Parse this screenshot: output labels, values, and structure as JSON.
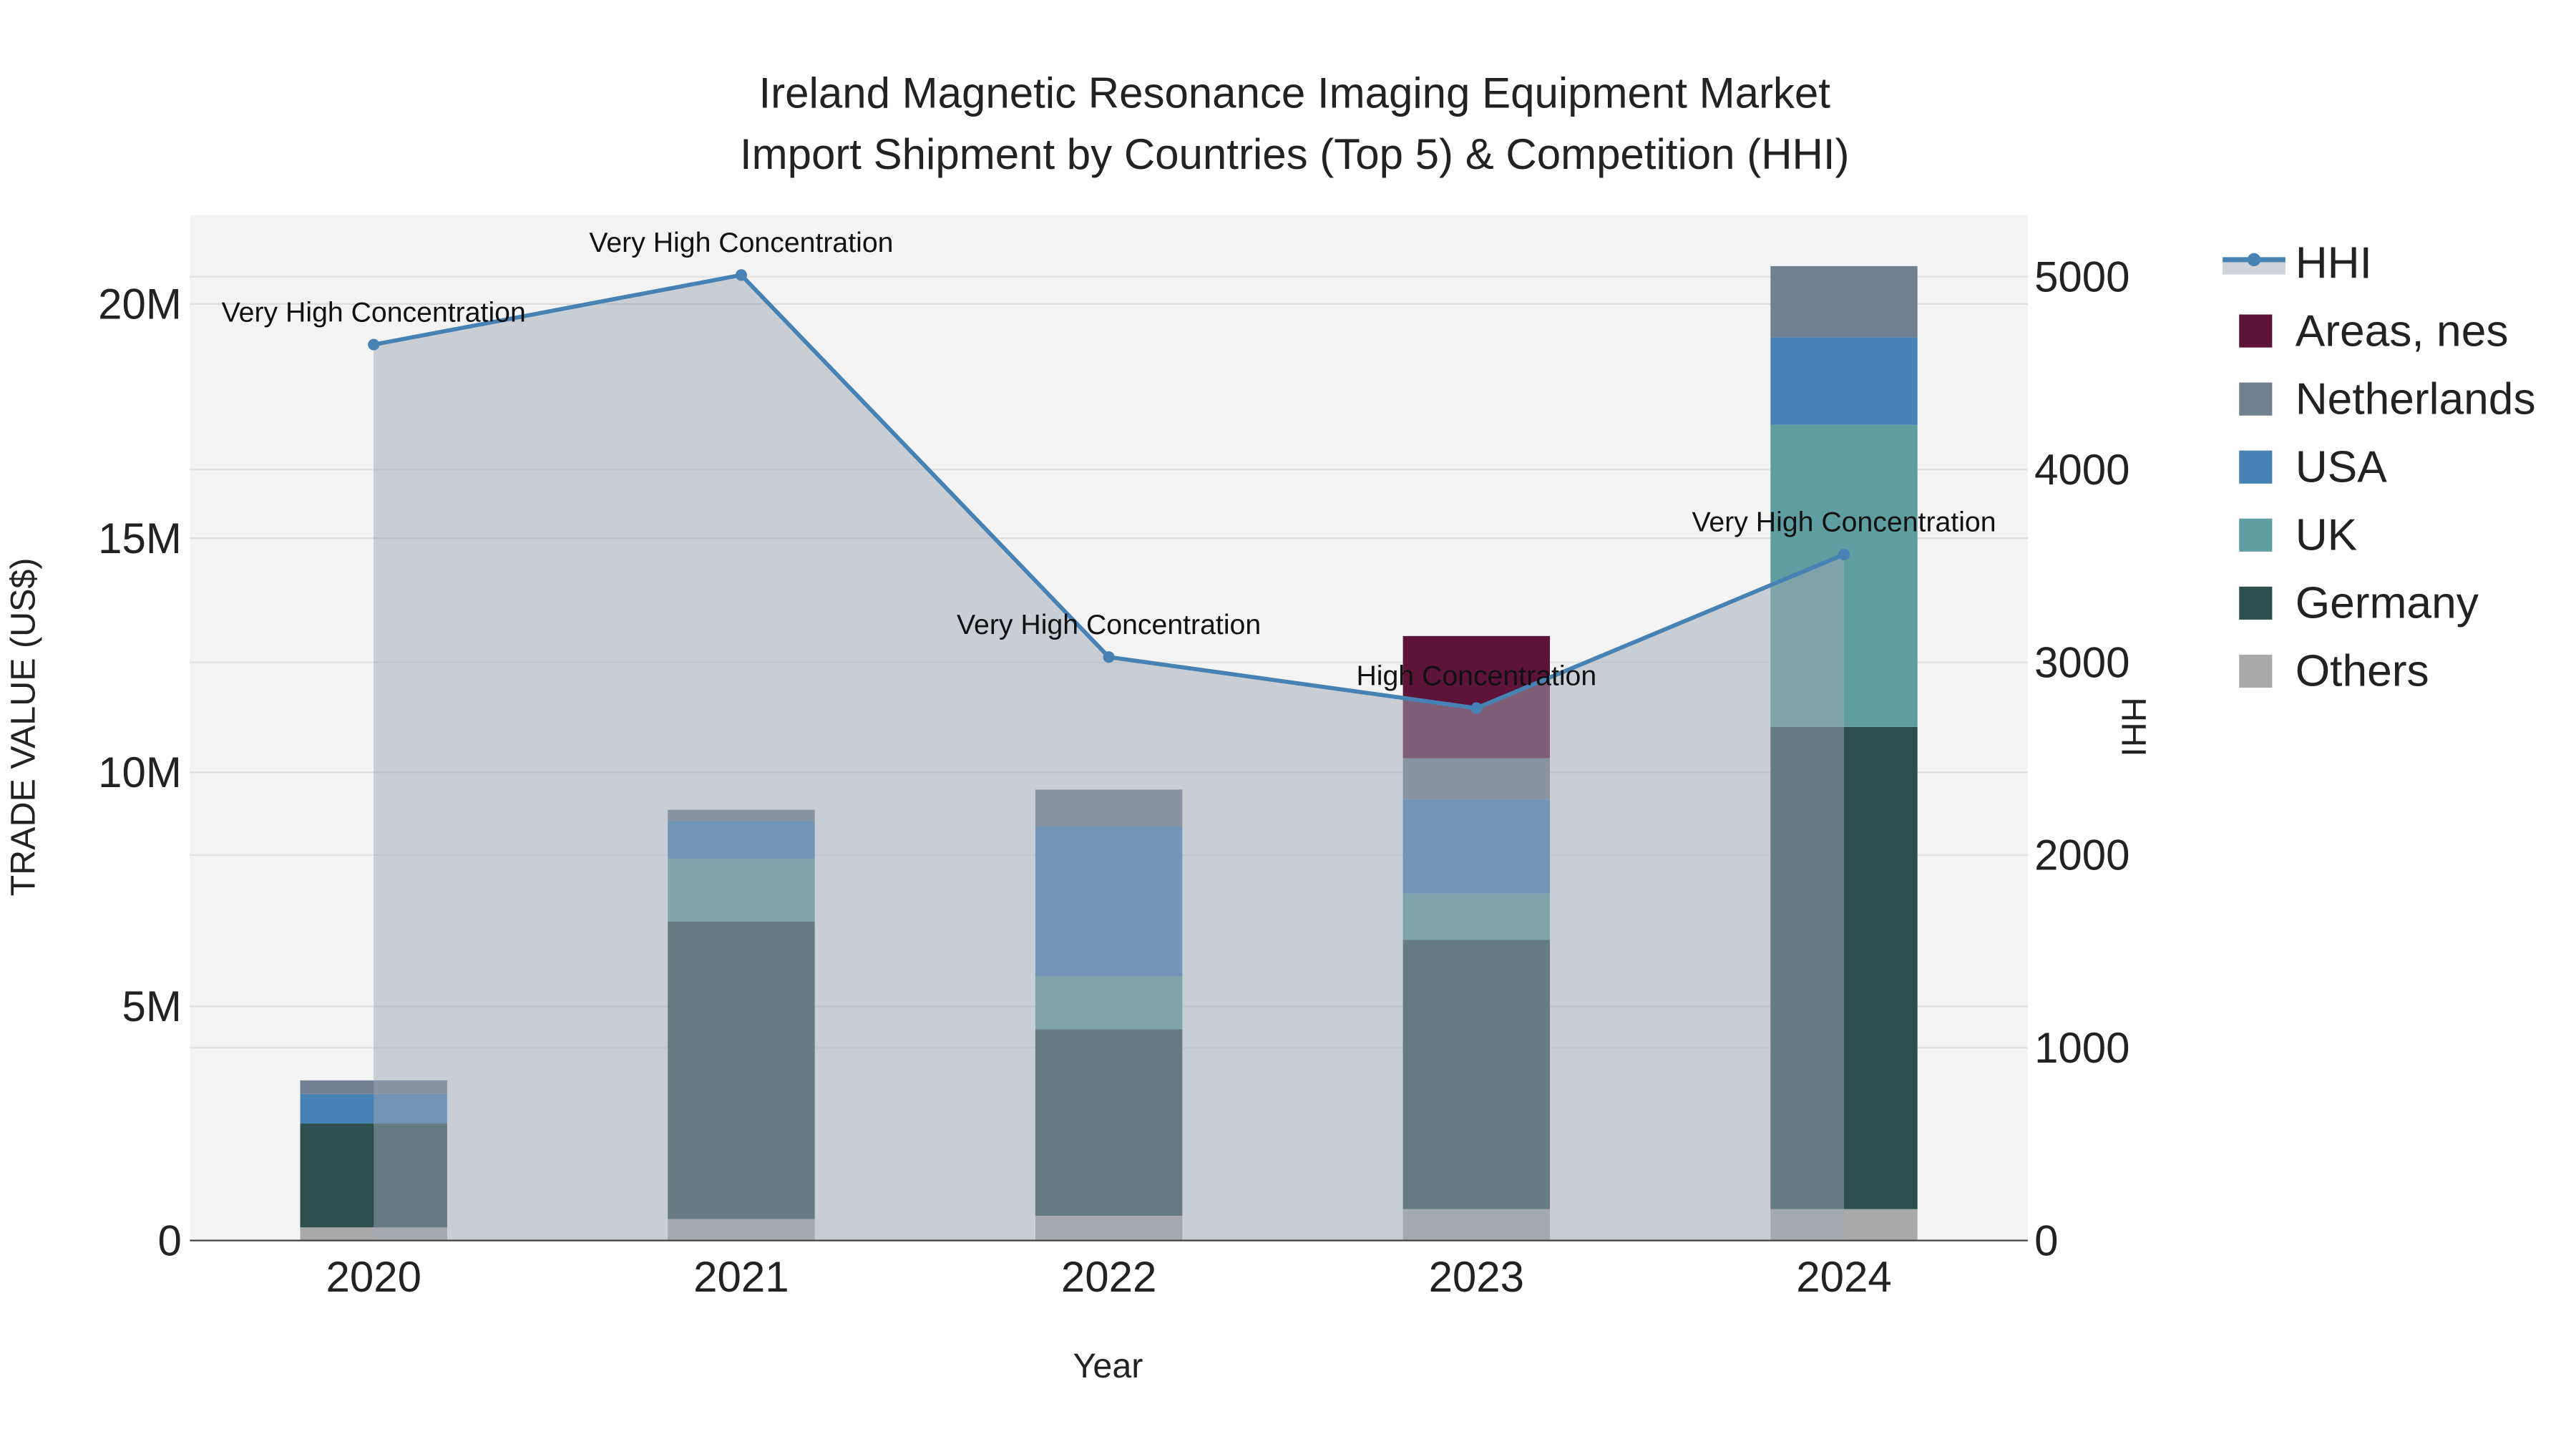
{
  "chart_data": {
    "type": "bar",
    "title_line1": "Ireland Magnetic Resonance Imaging Equipment Market",
    "title_line2": "Import Shipment by Countries (Top 5) & Competition (HHI)",
    "xlabel": "Year",
    "ylabel": "TRADE VALUE (US$)",
    "y2label": "HHI",
    "categories": [
      "2020",
      "2021",
      "2022",
      "2023",
      "2024"
    ],
    "ylim": [
      0,
      21.9
    ],
    "y2lim": [
      0,
      5320
    ],
    "yticks": [
      0,
      5,
      10,
      15,
      20
    ],
    "ytick_labels": [
      "0",
      "5M",
      "10M",
      "15M",
      "20M"
    ],
    "y2ticks": [
      0,
      1000,
      2000,
      3000,
      4000,
      5000
    ],
    "y2tick_labels": [
      "0",
      "1000",
      "2000",
      "3000",
      "4000",
      "5000"
    ],
    "units": "millions US$",
    "series": [
      {
        "name": "Others",
        "color": "#a9a9a9",
        "values": [
          0.28,
          0.46,
          0.53,
          0.67,
          0.67
        ]
      },
      {
        "name": "Germany",
        "color": "#2f4f4f",
        "values": [
          2.22,
          6.35,
          3.98,
          5.75,
          10.3
        ]
      },
      {
        "name": "UK",
        "color": "#5f9ea0",
        "values": [
          0.0,
          1.34,
          1.13,
          0.99,
          6.45
        ]
      },
      {
        "name": "USA",
        "color": "#4682b4",
        "values": [
          0.63,
          0.81,
          3.21,
          2.01,
          1.87
        ]
      },
      {
        "name": "Netherlands",
        "color": "#708090",
        "values": [
          0.29,
          0.24,
          0.78,
          0.88,
          1.52
        ]
      },
      {
        "name": "Areas, nes",
        "color": "#5d1438",
        "values": [
          0,
          0,
          0,
          2.61,
          0
        ]
      }
    ],
    "hhi": {
      "name": "HHI",
      "color": "#4682b4",
      "values": [
        4648,
        5009,
        3027,
        2762,
        3559
      ],
      "annotations": [
        "Very High Concentration",
        "Very High Concentration",
        "Very High Concentration",
        "High Concentration",
        "Very High Concentration"
      ]
    },
    "legend": [
      "HHI",
      "Areas, nes",
      "Netherlands",
      "USA",
      "UK",
      "Germany",
      "Others"
    ],
    "legend_position": "right",
    "grid": true
  }
}
